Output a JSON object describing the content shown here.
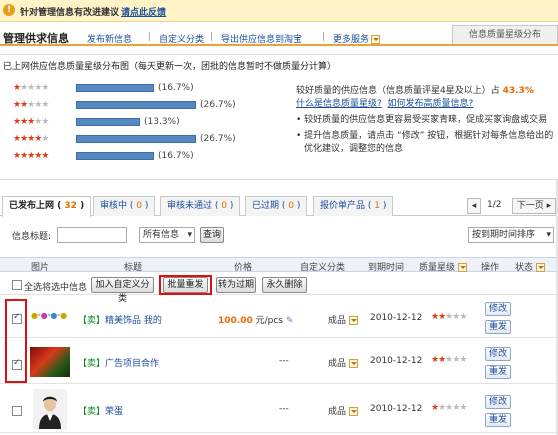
{
  "notice": {
    "text": "针对管理信息有改进建议",
    "link": "请点此反馈"
  },
  "header": {
    "title": "管理供求信息",
    "links": [
      "发布新信息",
      "自定义分类",
      "导出供应信息到淘宝",
      "更多服务"
    ],
    "right_tab": "信息质量星级分布"
  },
  "star_panel": {
    "heading": "已上网供应信息质量星级分布图（每天更新一次，团批的信息暂时不做质量分计算）",
    "rows": [
      {
        "stars": 1,
        "pct": "(16.7%)",
        "fraction": 0.167
      },
      {
        "stars": 2,
        "pct": "(26.7%)",
        "fraction": 0.267
      },
      {
        "stars": 3,
        "pct": "(13.3%)",
        "fraction": 0.133
      },
      {
        "stars": 4,
        "pct": "(26.7%)",
        "fraction": 0.267
      },
      {
        "stars": 5,
        "pct": "(16.7%)",
        "fraction": 0.167
      }
    ],
    "summary_prefix": "较好质量的供应信息（信息质量评星4星及以上）占",
    "summary_value": "43.3%",
    "link1": "什么是信息质量星级?",
    "link2": "如何发布高质量信息?",
    "bullet1": "较好质量的供应信息更容易受买家青睐，促成买家询盘或交易",
    "bullet2": "提升信息质量，请点击 “修改” 按钮，根据针对每条信息给出的优化建议，调整您的信息"
  },
  "tabs": [
    {
      "label": "已发布上网",
      "count": "32"
    },
    {
      "label": "审核中",
      "count": "0"
    },
    {
      "label": "审核未通过",
      "count": "0"
    },
    {
      "label": "已过期",
      "count": "0"
    },
    {
      "label": "报价单产品",
      "count": "1"
    }
  ],
  "pager": {
    "page": "1/2",
    "next": "下一页"
  },
  "filter": {
    "label": "信息标题:",
    "select": "所有信息",
    "query_button": "查询",
    "sort": "按到期时间排序"
  },
  "columns": [
    "图片",
    "标题",
    "价格",
    "自定义分类",
    "到期时间",
    "质量星级",
    "操作",
    "状态"
  ],
  "actions": {
    "select_all": "全选",
    "selected_label": "将选中信息",
    "buttons": [
      "加入自定义分类",
      "批量重发",
      "转为过期",
      "永久删除"
    ]
  },
  "rows": [
    {
      "title_prefix": "【卖】",
      "title": "精美饰品 我的",
      "price": "100.00",
      "unit": "元/pcs",
      "category": "成品",
      "expire": "2010-12-12",
      "stars": 2,
      "checked": true,
      "btn_edit": "修改",
      "btn_resend": "重发"
    },
    {
      "title_prefix": "【卖】",
      "title": "广告项目合作",
      "price": "---",
      "unit": "",
      "category": "成品",
      "expire": "2010-12-12",
      "stars": 2,
      "checked": true,
      "btn_edit": "修改",
      "btn_resend": "重发"
    },
    {
      "title_prefix": "【卖】",
      "title": "荣蛋",
      "price": "---",
      "unit": "",
      "category": "成品",
      "expire": "2010-12-12",
      "stars": 1,
      "checked": false,
      "btn_edit": "修改",
      "btn_resend": "重发"
    }
  ],
  "colors": {
    "accent_orange": "#e86a00",
    "link_blue": "#1a4d9c",
    "star_red": "#e23a12",
    "bar_blue": "#5689c2",
    "highlight_red": "#e01010"
  }
}
